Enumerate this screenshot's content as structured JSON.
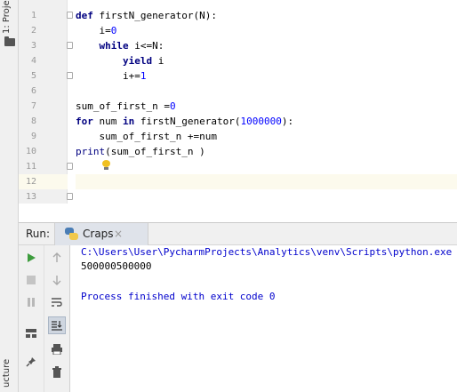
{
  "left_strip": {
    "project_tab": "1: Proje",
    "structure_tab": "ucture"
  },
  "editor": {
    "lines": [
      {
        "num": "1",
        "html": "<span class='kw'>def</span> firstN_generator(N):"
      },
      {
        "num": "2",
        "html": "    i=<span class='num'>0</span>"
      },
      {
        "num": "3",
        "html": "    <span class='kw'>while</span> i<=N:"
      },
      {
        "num": "4",
        "html": "        <span class='kw'>yield</span> i"
      },
      {
        "num": "5",
        "html": "        i+=<span class='num'>1</span>"
      },
      {
        "num": "6",
        "html": ""
      },
      {
        "num": "7",
        "html": "sum_of_first_n =<span class='num'>0</span>"
      },
      {
        "num": "8",
        "html": "<span class='kw'>for</span> num <span class='kw'>in</span> firstN_generator(<span class='num'>1000000</span>):"
      },
      {
        "num": "9",
        "html": "    sum_of_first_n +=num"
      },
      {
        "num": "10",
        "html": "<span class='fn'>print</span>(sum_of_first_n )"
      },
      {
        "num": "11",
        "html": ""
      },
      {
        "num": "12",
        "html": ""
      },
      {
        "num": "13",
        "html": ""
      }
    ],
    "current_line": "12"
  },
  "run_panel": {
    "label": "Run:",
    "tab_title": "Craps",
    "tab_close": "×",
    "console": {
      "command": "C:\\Users\\User\\PycharmProjects\\Analytics\\venv\\Scripts\\python.exe",
      "output": "500000500000",
      "blank": "",
      "process": "Process finished with exit code 0"
    }
  },
  "colors": {
    "keyword": "#000080",
    "number": "#0000ff",
    "console_link": "#0000cc",
    "run_green": "#3d9c3d",
    "current_line_bg": "#fcfaed"
  }
}
